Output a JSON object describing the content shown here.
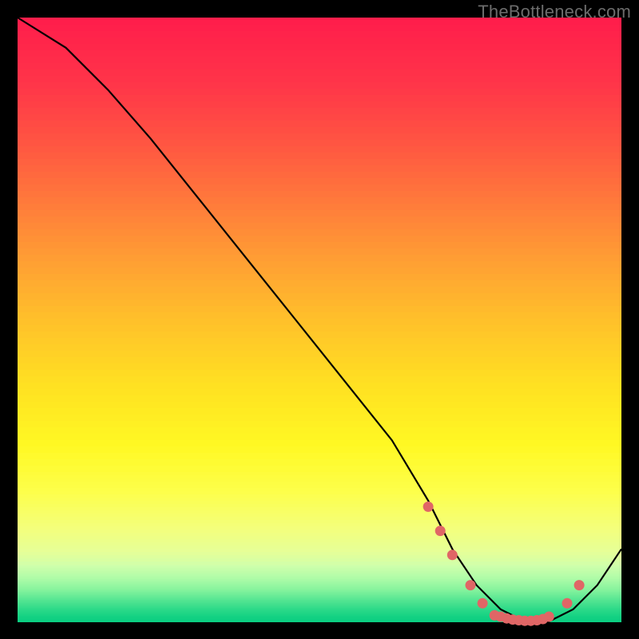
{
  "watermark": "TheBottleneck.com",
  "chart_data": {
    "type": "line",
    "title": "",
    "xlabel": "",
    "ylabel": "",
    "xlim": [
      0,
      100
    ],
    "ylim": [
      0,
      100
    ],
    "grid": false,
    "legend": false,
    "series": [
      {
        "name": "curve",
        "x": [
          0,
          8,
          15,
          22,
          30,
          38,
          46,
          54,
          62,
          68,
          72,
          76,
          80,
          84,
          88,
          92,
          96,
          100
        ],
        "y": [
          100,
          95,
          88,
          80,
          70,
          60,
          50,
          40,
          30,
          20,
          12,
          6,
          2,
          0,
          0,
          2,
          6,
          12
        ]
      }
    ],
    "markers": {
      "name": "highlight-dots",
      "color": "#e06666",
      "x": [
        68,
        70,
        72,
        75,
        77,
        79,
        80,
        81,
        82,
        83,
        84,
        85,
        86,
        87,
        88,
        91,
        93
      ],
      "y": [
        19,
        15,
        11,
        6,
        3,
        1,
        0.8,
        0.5,
        0.3,
        0.2,
        0.1,
        0.1,
        0.2,
        0.4,
        0.8,
        3,
        6
      ]
    },
    "background_gradient": {
      "stops": [
        {
          "pos": 0.0,
          "color": "#ff1e4b"
        },
        {
          "pos": 0.1,
          "color": "#ff3449"
        },
        {
          "pos": 0.2,
          "color": "#ff5542"
        },
        {
          "pos": 0.3,
          "color": "#ff7a3b"
        },
        {
          "pos": 0.4,
          "color": "#ffa033"
        },
        {
          "pos": 0.5,
          "color": "#ffc22a"
        },
        {
          "pos": 0.6,
          "color": "#ffe022"
        },
        {
          "pos": 0.7,
          "color": "#fff823"
        },
        {
          "pos": 0.78,
          "color": "#fdff4a"
        },
        {
          "pos": 0.84,
          "color": "#f4ff7a"
        },
        {
          "pos": 0.88,
          "color": "#e6ff97"
        },
        {
          "pos": 0.905,
          "color": "#cfffab"
        },
        {
          "pos": 0.925,
          "color": "#b0fca8"
        },
        {
          "pos": 0.945,
          "color": "#86f39d"
        },
        {
          "pos": 0.962,
          "color": "#55e592"
        },
        {
          "pos": 0.978,
          "color": "#2bd988"
        },
        {
          "pos": 0.99,
          "color": "#13d183"
        },
        {
          "pos": 1.0,
          "color": "#08cd80"
        }
      ]
    }
  }
}
